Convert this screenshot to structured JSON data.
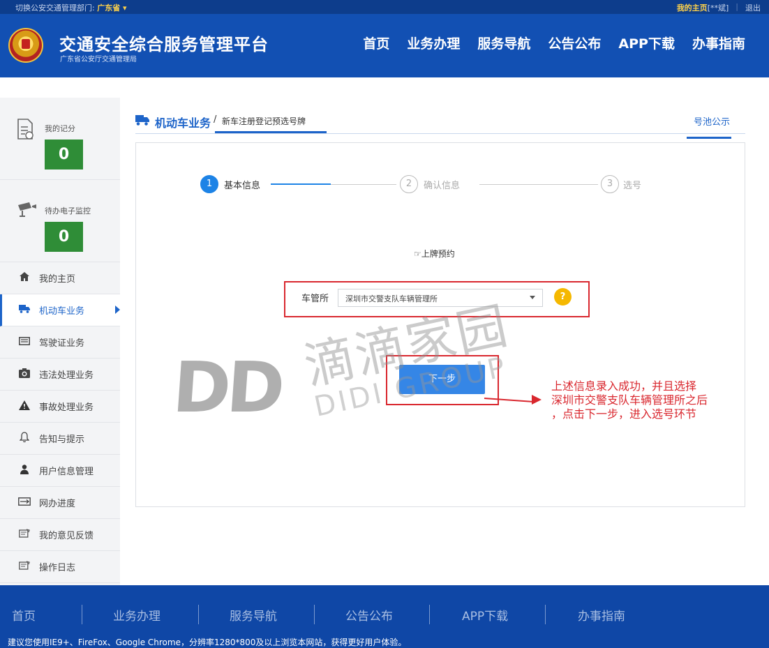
{
  "topbar": {
    "switch_label": "切换公安交通管理部门:",
    "province": "广东省 ▾",
    "home_link": "我的主页",
    "user_masked": "[**斌]",
    "logout": "退出"
  },
  "header": {
    "title": "交通安全综合服务管理平台",
    "subtitle": "广东省公安厅交通管理局",
    "nav": [
      "首页",
      "业务办理",
      "服务导航",
      "公告公布",
      "APP下载",
      "办事指南"
    ]
  },
  "sidebar": {
    "points_label": "我的记分",
    "points_value": "0",
    "monitor_label": "待办电子监控",
    "monitor_value": "0",
    "items": [
      {
        "label": "我的主页",
        "icon": "home-icon"
      },
      {
        "label": "机动车业务",
        "icon": "truck-icon",
        "active": true
      },
      {
        "label": "驾驶证业务",
        "icon": "card-icon"
      },
      {
        "label": "违法处理业务",
        "icon": "camera-icon"
      },
      {
        "label": "事故处理业务",
        "icon": "warning-icon"
      },
      {
        "label": "告知与提示",
        "icon": "bell-icon"
      },
      {
        "label": "用户信息管理",
        "icon": "user-icon"
      },
      {
        "label": "网办进度",
        "icon": "progress-icon"
      },
      {
        "label": "我的意见反馈",
        "icon": "feedback-icon"
      },
      {
        "label": "操作日志",
        "icon": "log-icon"
      }
    ]
  },
  "breadcrumb": {
    "section": "机动车业务",
    "separator": "/",
    "current": "新车注册登记预选号牌",
    "right_link": "号池公示"
  },
  "steps": [
    {
      "num": "1",
      "label": "基本信息",
      "state": "active"
    },
    {
      "num": "2",
      "label": "确认信息",
      "state": "idle"
    },
    {
      "num": "3",
      "label": "选号",
      "state": "idle"
    }
  ],
  "form": {
    "reserve_text": "☞上牌预约",
    "station_label": "车管所",
    "station_value": "深圳市交警支队车辆管理所",
    "help_symbol": "?",
    "next_button": "下一步"
  },
  "watermark": {
    "letters": "DD",
    "cn": "滴滴家园",
    "en": "DIDI GROUP"
  },
  "annotation": {
    "lines": [
      "上述信息录入成功，并且选择",
      "深圳市交警支队车辆管理所之后",
      "，点击下一步，进入选号环节"
    ]
  },
  "footer": {
    "nav": [
      "首页",
      "业务办理",
      "服务导航",
      "公告公布",
      "APP下载",
      "办事指南"
    ],
    "note": "建议您使用IE9+、FireFox、Google Chrome，分辨率1280*800及以上浏览本网站，获得更好用户体验。"
  },
  "colors": {
    "header_bg": "#1250b3",
    "topbar_bg": "#0d3d8c",
    "accent": "#1d64c9",
    "count_green": "#2f8d37",
    "annotation_red": "#d9272e",
    "button_blue": "#3586e6"
  }
}
